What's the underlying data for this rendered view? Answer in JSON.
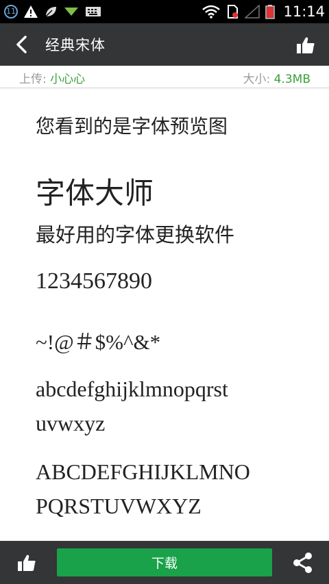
{
  "status_bar": {
    "notification_count": "11",
    "time": "11:14"
  },
  "header": {
    "title": "经典宋体",
    "back_icon": "chevron-left-icon",
    "like_icon": "thumbs-up-icon"
  },
  "info": {
    "uploader_label": "上传:",
    "uploader_value": "小心心",
    "size_label": "大小:",
    "size_value": "4.3MB"
  },
  "preview": {
    "line1": "您看到的是字体预览图",
    "line2": "字体大师",
    "line3": "最好用的字体更换软件",
    "line4": "1234567890",
    "line5": "~!@＃$%^&*",
    "line6": "abcdefghijklmnopqrst",
    "line7": "uvwxyz",
    "line8": "ABCDEFGHIJKLMNO",
    "line9": "PQRSTUVWXYZ"
  },
  "bottom": {
    "download_label": "下载"
  },
  "colors": {
    "app_bar": "#333537",
    "accent_green": "#1aa24a",
    "value_green": "#3aa03a"
  }
}
